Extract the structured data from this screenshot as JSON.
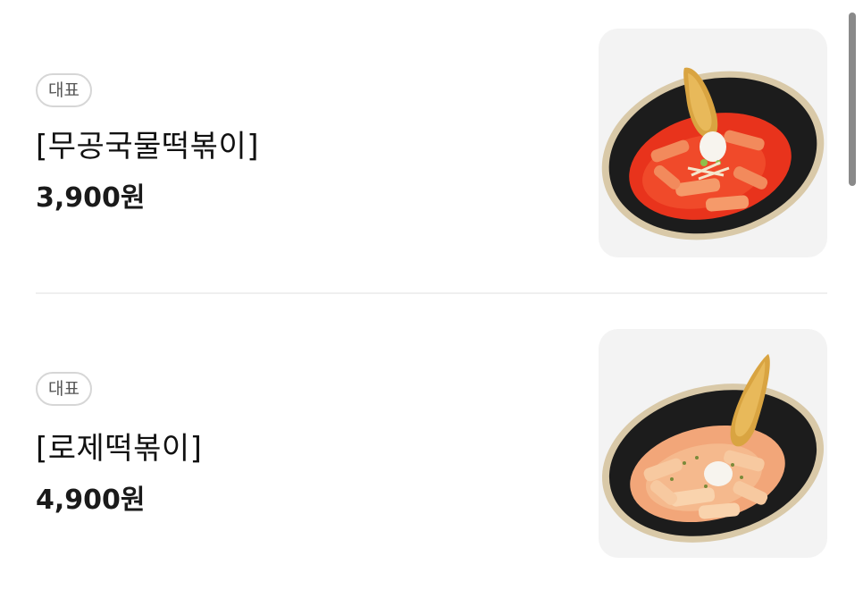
{
  "menu": {
    "items": [
      {
        "badge": "대표",
        "name": "[무공국물떡볶이]",
        "price": "3,900원",
        "image_icon": "tteokbokki-soup-image"
      },
      {
        "badge": "대표",
        "name": "[로제떡볶이]",
        "price": "4,900원",
        "image_icon": "rose-tteokbokki-image"
      }
    ]
  },
  "colors": {
    "background": "#ffffff",
    "thumb_background": "#f3f3f3",
    "divider": "#efefef",
    "badge_border": "#d6d6d6",
    "spicy_sauce": "#e8331c",
    "rose_sauce": "#f2a679",
    "bowl": "#1c1c1c",
    "scrollbar": "#8a8a8a"
  }
}
